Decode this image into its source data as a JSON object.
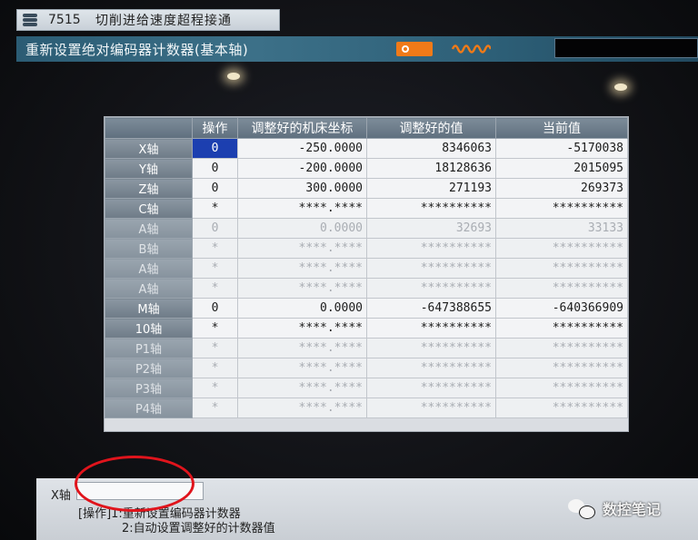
{
  "title_bar": {
    "code": "7515",
    "message": "切削进给速度超程接通"
  },
  "mode_bar": {
    "title": "重新设置绝对编码器计数器(基本轴)",
    "lock_text": "⊏⊸ ▯▯"
  },
  "table": {
    "headers": [
      "",
      "操作",
      "调整好的机床坐标",
      "调整好的值",
      "当前值"
    ],
    "rows": [
      {
        "axis": "X轴",
        "op": "0",
        "coord": "-250.0000",
        "adjusted": "8346063",
        "current": "-5170038",
        "dim": false,
        "selected": true
      },
      {
        "axis": "Y轴",
        "op": "0",
        "coord": "-200.0000",
        "adjusted": "18128636",
        "current": "2015095",
        "dim": false,
        "selected": false
      },
      {
        "axis": "Z轴",
        "op": "0",
        "coord": "300.0000",
        "adjusted": "271193",
        "current": "269373",
        "dim": false,
        "selected": false
      },
      {
        "axis": "C轴",
        "op": "*",
        "coord": "****.****",
        "adjusted": "**********",
        "current": "**********",
        "dim": false,
        "selected": false
      },
      {
        "axis": "A轴",
        "op": "0",
        "coord": "0.0000",
        "adjusted": "32693",
        "current": "33133",
        "dim": true,
        "selected": false
      },
      {
        "axis": "B轴",
        "op": "*",
        "coord": "****.****",
        "adjusted": "**********",
        "current": "**********",
        "dim": true,
        "selected": false
      },
      {
        "axis": "A轴",
        "op": "*",
        "coord": "****.****",
        "adjusted": "**********",
        "current": "**********",
        "dim": true,
        "selected": false
      },
      {
        "axis": "A轴",
        "op": "*",
        "coord": "****.****",
        "adjusted": "**********",
        "current": "**********",
        "dim": true,
        "selected": false
      },
      {
        "axis": "M轴",
        "op": "0",
        "coord": "0.0000",
        "adjusted": "-647388655",
        "current": "-640366909",
        "dim": false,
        "selected": false
      },
      {
        "axis": "10轴",
        "op": "*",
        "coord": "****.****",
        "adjusted": "**********",
        "current": "**********",
        "dim": false,
        "selected": false
      },
      {
        "axis": "P1轴",
        "op": "*",
        "coord": "****.****",
        "adjusted": "**********",
        "current": "**********",
        "dim": true,
        "selected": false
      },
      {
        "axis": "P2轴",
        "op": "*",
        "coord": "****.****",
        "adjusted": "**********",
        "current": "**********",
        "dim": true,
        "selected": false
      },
      {
        "axis": "P3轴",
        "op": "*",
        "coord": "****.****",
        "adjusted": "**********",
        "current": "**********",
        "dim": true,
        "selected": false
      },
      {
        "axis": "P4轴",
        "op": "*",
        "coord": "****.****",
        "adjusted": "**********",
        "current": "**********",
        "dim": true,
        "selected": false
      }
    ]
  },
  "input": {
    "label": "X轴",
    "value": "",
    "guide_line1": "[操作]1:重新设置编码器计数器",
    "guide_line2": "2:自动设置调整好的计数器值"
  },
  "watermark": {
    "text": "数控笔记"
  },
  "colors": {
    "mode_bar": "#3c7088",
    "selected_cell": "#1c3fb0",
    "annotation_circle": "#e0141c",
    "lock_icon": "#f07a18"
  }
}
